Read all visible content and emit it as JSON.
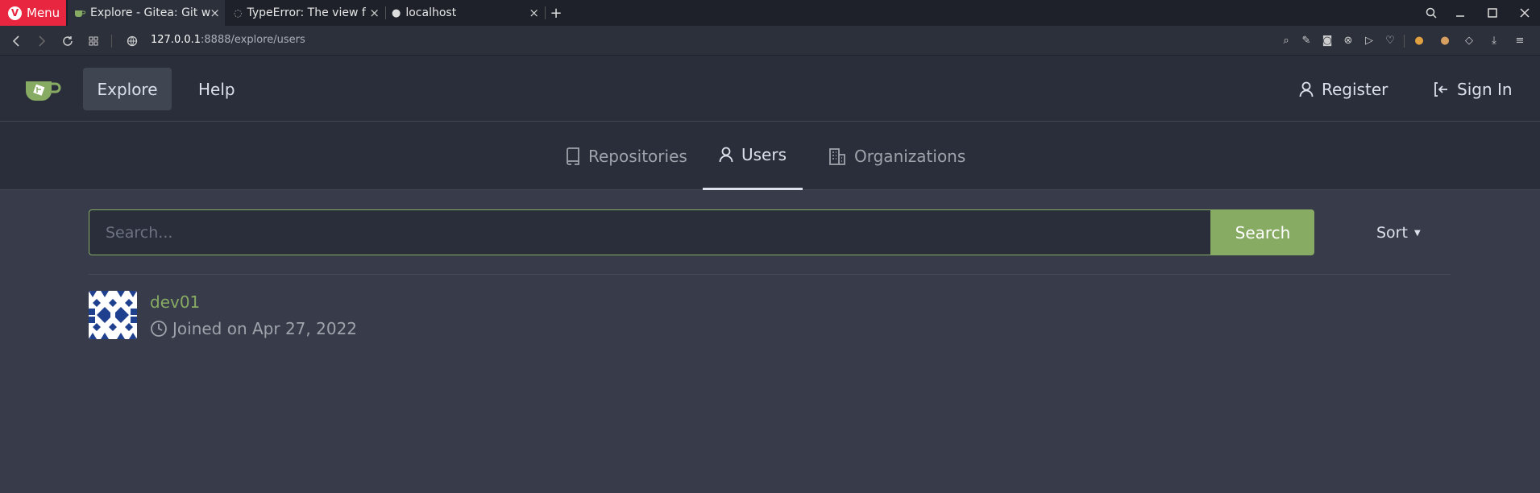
{
  "browser": {
    "menu_label": "Menu",
    "tabs": [
      {
        "title": "Explore - Gitea: Git w",
        "close": "×"
      },
      {
        "title": "TypeError: The view f",
        "close": "×"
      },
      {
        "title": "localhost",
        "close": "×"
      }
    ],
    "new_tab": "+",
    "url_host": "127.0.0.1",
    "url_path": ":8888/explore/users"
  },
  "header": {
    "explore_label": "Explore",
    "help_label": "Help",
    "register_label": "Register",
    "signin_label": "Sign In"
  },
  "tabs": [
    {
      "label": "Repositories",
      "icon": "repo-icon"
    },
    {
      "label": "Users",
      "icon": "person-icon",
      "active": true
    },
    {
      "label": "Organizations",
      "icon": "organization-icon"
    }
  ],
  "search": {
    "placeholder": "Search...",
    "value": "",
    "button_label": "Search",
    "sort_label": "Sort"
  },
  "users": [
    {
      "name": "dev01",
      "joined": "Joined on Apr 27, 2022"
    }
  ],
  "colors": {
    "accent": "#87ab63",
    "background": "#383c4a",
    "header": "#2a2e3a",
    "vivaldi_red": "#e8263f"
  }
}
